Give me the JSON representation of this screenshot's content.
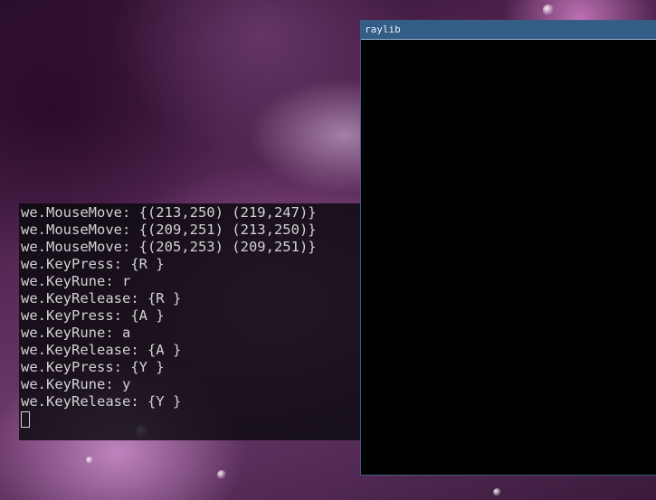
{
  "terminal": {
    "lines": [
      "we.MouseMove: {(213,250) (219,247)}",
      "we.MouseMove: {(209,251) (213,250)}",
      "we.MouseMove: {(205,253) (209,251)}",
      "we.KeyPress: {R }",
      "we.KeyRune: r",
      "we.KeyRelease: {R }",
      "we.KeyPress: {A }",
      "we.KeyRune: a",
      "we.KeyRelease: {A }",
      "we.KeyPress: {Y }",
      "we.KeyRune: y",
      "we.KeyRelease: {Y }"
    ]
  },
  "window": {
    "title": "raylib"
  },
  "colors": {
    "titlebar": "#335c86",
    "terminal_text": "#d2d2d2",
    "canvas": "#000000"
  }
}
